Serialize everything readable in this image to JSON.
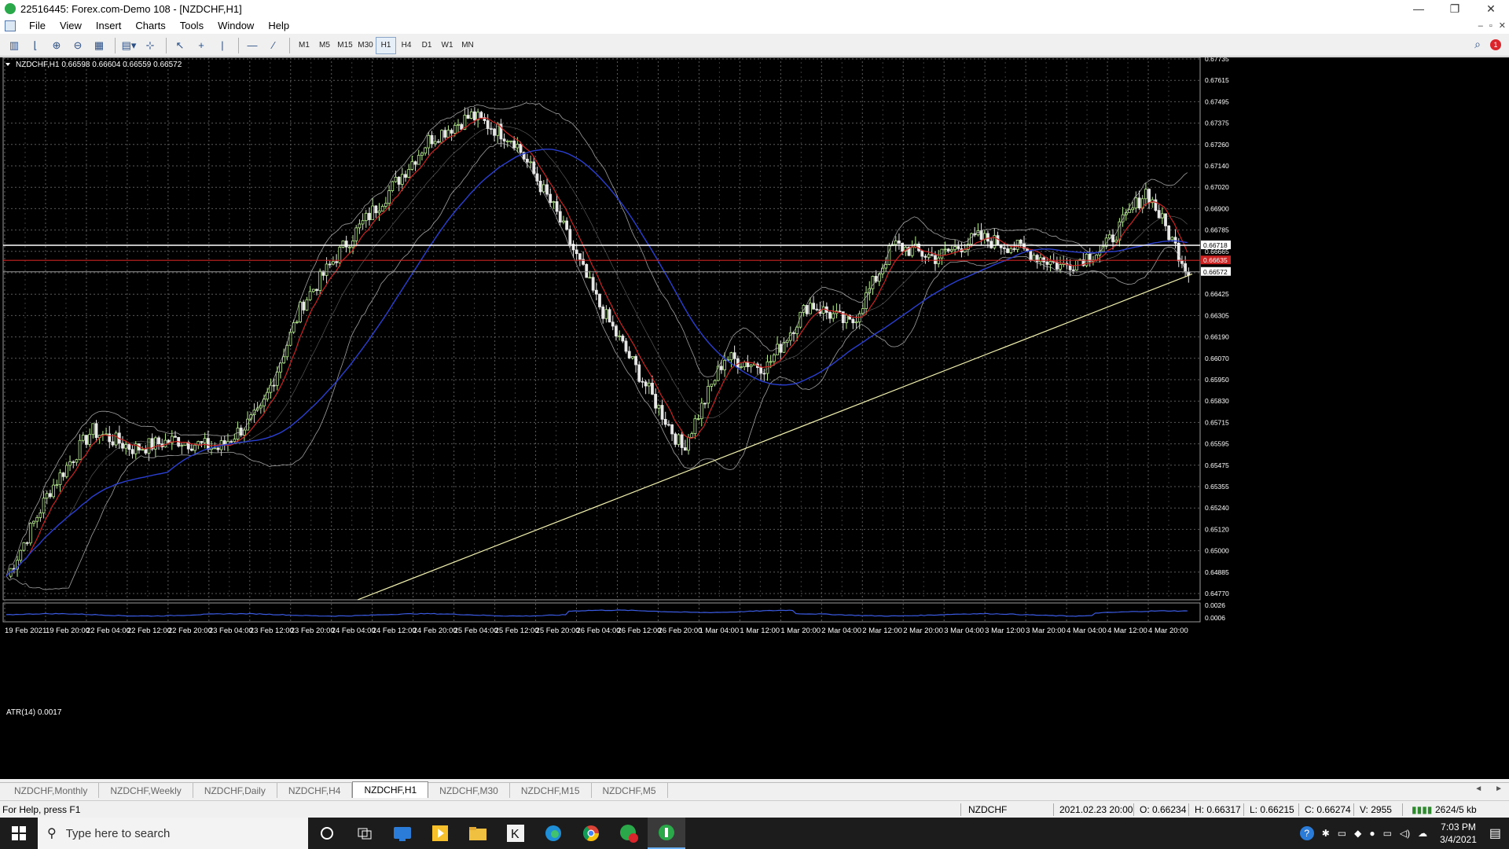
{
  "window": {
    "title": "22516445: Forex.com-Demo 108 - [NZDCHF,H1]",
    "minimize": "—",
    "maximize": "❐",
    "close": "✕"
  },
  "menu": {
    "items": [
      "File",
      "View",
      "Insert",
      "Charts",
      "Tools",
      "Window",
      "Help"
    ]
  },
  "mdi": {
    "minimize": "–",
    "restore": "▫",
    "close": "✕"
  },
  "toolbar": {
    "icons": [
      "new-chart-icon",
      "profiles-icon",
      "zoom-in-icon",
      "zoom-out-icon",
      "tile-windows-icon",
      "templates-icon",
      "crosshair-target-icon",
      "cursor-icon",
      "crosshair-icon",
      "vertical-line-icon",
      "horizontal-line-icon",
      "trendline-icon"
    ],
    "timeframes": [
      "M1",
      "M5",
      "M15",
      "M30",
      "H1",
      "H4",
      "D1",
      "W1",
      "MN"
    ],
    "active_timeframe": "H1",
    "alert_count": "1"
  },
  "chart": {
    "header": "NZDCHF,H1  0.66598 0.66604 0.66559 0.66572",
    "price_axis": [
      "0.67735",
      "0.67615",
      "0.67495",
      "0.67375",
      "0.67260",
      "0.67140",
      "0.67020",
      "0.66900",
      "0.66785",
      "0.66665",
      "0.66545",
      "0.66425",
      "0.66305",
      "0.66190",
      "0.66070",
      "0.65950",
      "0.65830",
      "0.65715",
      "0.65595",
      "0.65475",
      "0.65355",
      "0.65240",
      "0.65120",
      "0.65000",
      "0.64885",
      "0.64770"
    ],
    "price_labels": {
      "white_line": "0.66718",
      "red_line": "0.66635",
      "bid": "0.66572"
    },
    "time_axis": [
      "19 Feb 2021",
      "19 Feb 20:00",
      "22 Feb 04:00",
      "22 Feb 12:00",
      "22 Feb 20:00",
      "23 Feb 04:00",
      "23 Feb 12:00",
      "23 Feb 20:00",
      "24 Feb 04:00",
      "24 Feb 12:00",
      "24 Feb 20:00",
      "25 Feb 04:00",
      "25 Feb 12:00",
      "25 Feb 20:00",
      "26 Feb 04:00",
      "26 Feb 12:00",
      "26 Feb 20:00",
      "1 Mar 04:00",
      "1 Mar 12:00",
      "1 Mar 20:00",
      "2 Mar 04:00",
      "2 Mar 12:00",
      "2 Mar 20:00",
      "3 Mar 04:00",
      "3 Mar 12:00",
      "3 Mar 20:00",
      "4 Mar 04:00",
      "4 Mar 12:00",
      "4 Mar 20:00"
    ],
    "atr_label": "ATR(14) 0.0017",
    "atr_axis": [
      "0.0026",
      "0.0006"
    ],
    "colors": {
      "background": "#000000",
      "grid": "#5a5a5a",
      "bull": "#b8ee8f",
      "bear": "#e8e8e8",
      "ma_red": "#cc2222",
      "ma_blue": "#2a3fd0",
      "bands": "#c8c8c8",
      "trend": "#f2f2b0",
      "atr": "#3a5ae0"
    }
  },
  "chart_data": {
    "type": "line",
    "title": "NZDCHF,H1",
    "ohlc_header": {
      "open": 0.66598,
      "high": 0.66604,
      "low": 0.66559,
      "close": 0.66572
    },
    "x": [
      "19 Feb 2021",
      "19 Feb 20:00",
      "22 Feb 04:00",
      "22 Feb 12:00",
      "22 Feb 20:00",
      "23 Feb 04:00",
      "23 Feb 12:00",
      "23 Feb 20:00",
      "24 Feb 04:00",
      "24 Feb 12:00",
      "24 Feb 20:00",
      "25 Feb 04:00",
      "25 Feb 12:00",
      "25 Feb 20:00",
      "26 Feb 04:00",
      "26 Feb 12:00",
      "26 Feb 20:00",
      "1 Mar 04:00",
      "1 Mar 12:00",
      "1 Mar 20:00",
      "2 Mar 04:00",
      "2 Mar 12:00",
      "2 Mar 20:00",
      "3 Mar 04:00",
      "3 Mar 12:00",
      "3 Mar 20:00",
      "4 Mar 04:00",
      "4 Mar 12:00",
      "4 Mar 20:00"
    ],
    "series": [
      {
        "values": [
          0.649,
          0.6537,
          0.657,
          0.656,
          0.6565,
          0.656,
          0.658,
          0.664,
          0.6672,
          0.67,
          0.673,
          0.6743,
          0.673,
          0.669,
          0.664,
          0.66,
          0.656,
          0.661,
          0.6605,
          0.664,
          0.6628,
          0.6672,
          0.6665,
          0.6676,
          0.667,
          0.666,
          0.667,
          0.6702,
          0.6657
        ]
      }
    ],
    "ylim": [
      0.6477,
      0.6775
    ],
    "indicator": {
      "name": "ATR(14)",
      "value": 0.0017,
      "ylim": [
        0.0006,
        0.0026
      ]
    }
  },
  "tabs": {
    "items": [
      "NZDCHF,Monthly",
      "NZDCHF,Weekly",
      "NZDCHF,Daily",
      "NZDCHF,H4",
      "NZDCHF,H1",
      "NZDCHF,M30",
      "NZDCHF,M15",
      "NZDCHF,M5"
    ],
    "active": "NZDCHF,H1",
    "arrow_left": "◄",
    "arrow_right": "►"
  },
  "status": {
    "help": "For Help, press F1",
    "symbol": "NZDCHF",
    "datetime": "2021.02.23 20:00",
    "open": "O: 0.66234",
    "high": "H: 0.66317",
    "low": "L: 0.66215",
    "close": "C: 0.66274",
    "volume": "V: 2955",
    "traffic": "2624/5 kb"
  },
  "taskbar": {
    "search_placeholder": "Type here to search",
    "apps": [
      "cortana-icon",
      "task-view-icon",
      "app-blue-icon",
      "app-yellow-icon",
      "file-explorer-icon",
      "app-k-icon",
      "edge-icon",
      "chrome-icon",
      "metatrader-notify-icon",
      "metatrader-icon"
    ],
    "time": "7:03 PM",
    "date": "3/4/2021"
  }
}
